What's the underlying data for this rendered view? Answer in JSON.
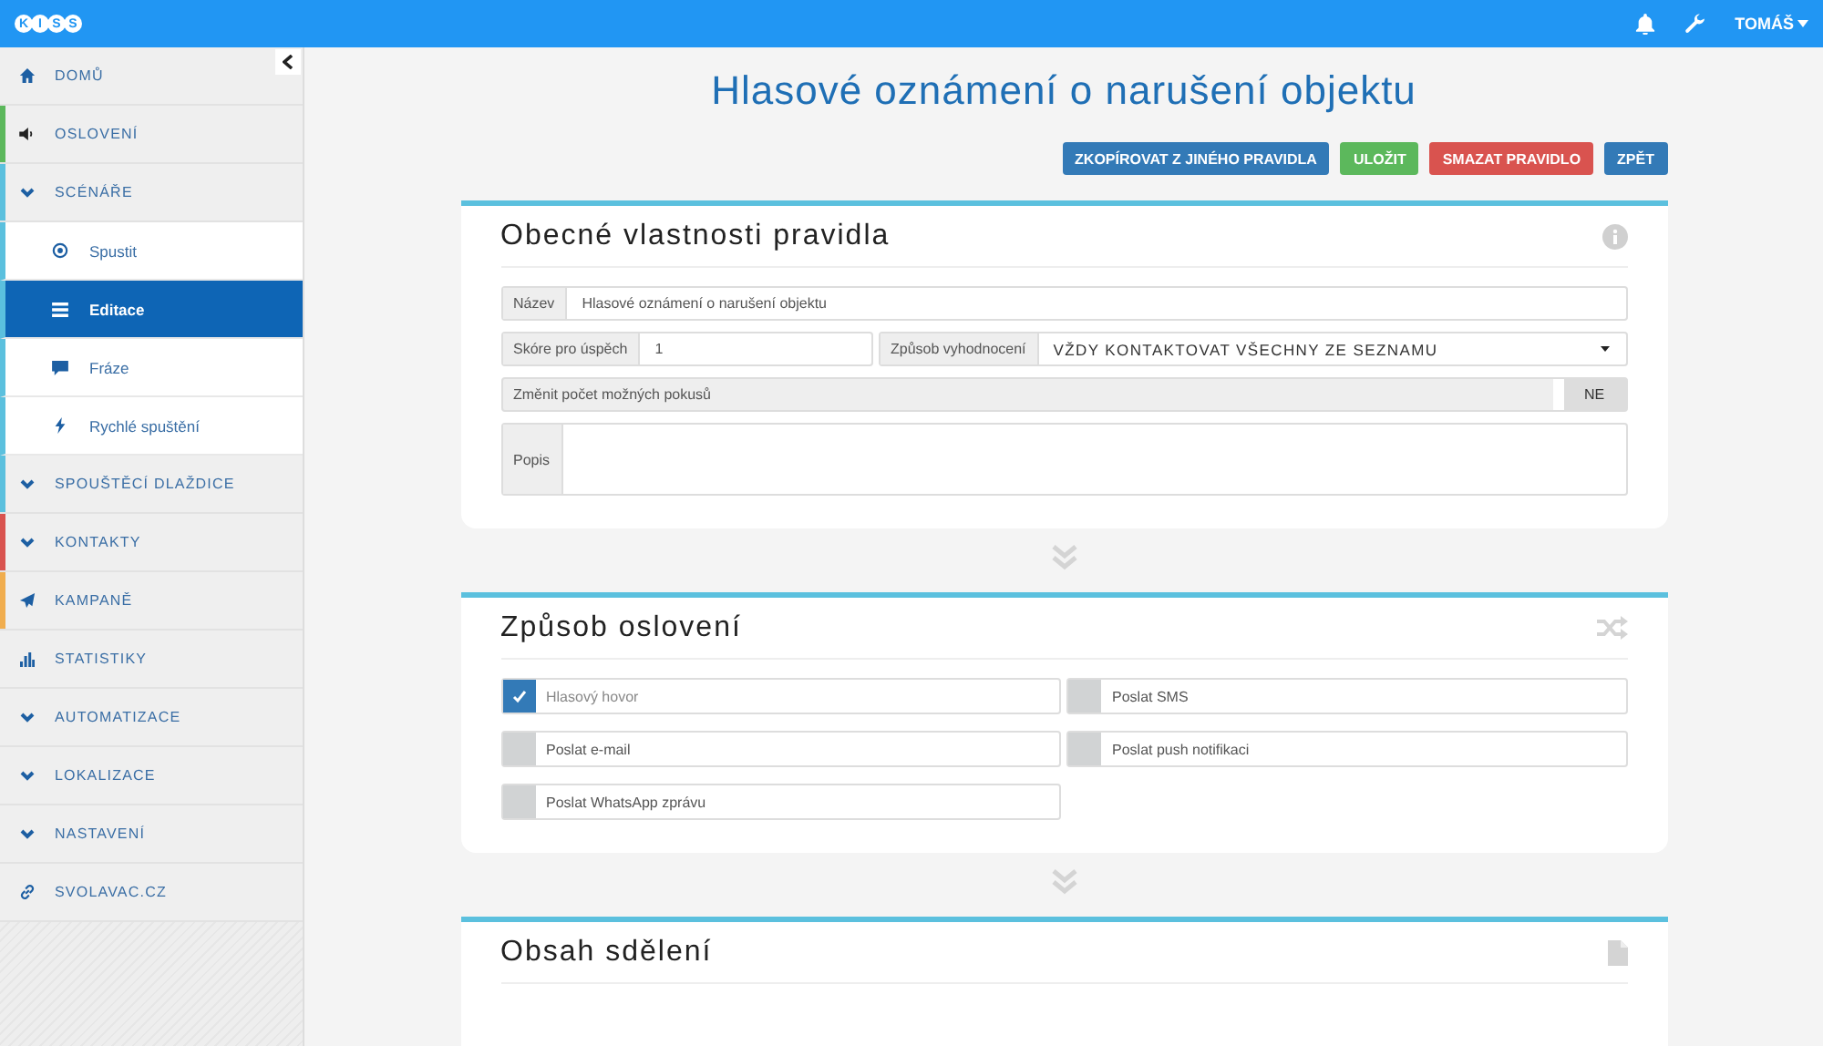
{
  "header": {
    "logo": [
      "K",
      "I",
      "S",
      "S"
    ],
    "user": "TOMÁŠ"
  },
  "sidebar": {
    "items": [
      {
        "label": "DOMŮ",
        "kind": "link"
      },
      {
        "label": "OSLOVENÍ",
        "kind": "link",
        "color": "#5cb85c"
      },
      {
        "label": "SCÉNÁŘE",
        "kind": "group",
        "color": "#5bc0de",
        "children": [
          {
            "label": "Spustit",
            "selected": false
          },
          {
            "label": "Editace",
            "selected": true
          },
          {
            "label": "Fráze",
            "selected": false
          },
          {
            "label": "Rychlé spuštění",
            "selected": false
          }
        ]
      },
      {
        "label": "SPOUŠTĚCÍ DLAŽDICE",
        "kind": "group",
        "color": "#5bc0de"
      },
      {
        "label": "KONTAKTY",
        "kind": "group",
        "color": "#d9534f"
      },
      {
        "label": "KAMPANĚ",
        "kind": "link",
        "color": "#f0ad4e"
      },
      {
        "label": "STATISTIKY",
        "kind": "link"
      },
      {
        "label": "AUTOMATIZACE",
        "kind": "group"
      },
      {
        "label": "LOKALIZACE",
        "kind": "group"
      },
      {
        "label": "NASTAVENÍ",
        "kind": "group"
      },
      {
        "label": "SVOLAVAC.CZ",
        "kind": "link"
      }
    ]
  },
  "main": {
    "title": "Hlasové oznámení o narušení objektu",
    "buttons": [
      {
        "label": "ZKOPÍROVAT Z JINÉHO PRAVIDLA",
        "kind": "primary"
      },
      {
        "label": "ULOŽIT",
        "kind": "success"
      },
      {
        "label": "SMAZAT PRAVIDLO",
        "kind": "danger"
      },
      {
        "label": "ZPĚT",
        "kind": "primary"
      }
    ],
    "general": {
      "title": "Obecné vlastnosti pravidla",
      "name": {
        "label": "Název",
        "value": "Hlasové oznámení o narušení objektu"
      },
      "score": {
        "label": "Skóre pro úspěch",
        "value": "1"
      },
      "evaluation": {
        "label": "Způsob vyhodnocení",
        "value": "VŽDY KONTAKTOVAT VŠECHNY ZE SEZNAMU"
      },
      "attempts": {
        "label": "Změnit počet možných pokusů",
        "toggle": "NE",
        "on": false
      },
      "description": {
        "label": "Popis"
      }
    },
    "salutation": {
      "title": "Způsob oslovení",
      "options": [
        {
          "label": "Hlasový hovor",
          "checked": true
        },
        {
          "label": "Poslat SMS",
          "checked": false
        },
        {
          "label": "Poslat e-mail",
          "checked": false
        },
        {
          "label": "Poslat push notifikaci",
          "checked": false
        },
        {
          "label": "Poslat WhatsApp zprávu",
          "checked": false
        }
      ]
    },
    "content": {
      "title": "Obsah sdělení"
    }
  }
}
